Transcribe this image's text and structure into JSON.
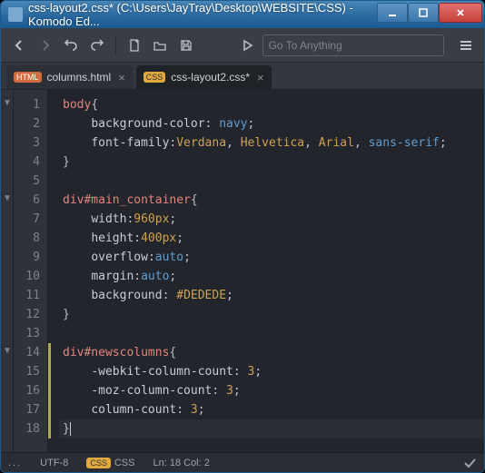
{
  "window": {
    "title": "css-layout2.css* (C:\\Users\\JayTray\\Desktop\\WEBSITE\\CSS) - Komodo Ed..."
  },
  "search": {
    "placeholder": "Go To Anything"
  },
  "tabs": [
    {
      "badge": "HTML",
      "label": "columns.html",
      "active": false
    },
    {
      "badge": "CSS",
      "label": "css-layout2.css*",
      "active": true
    }
  ],
  "code": {
    "lines": [
      {
        "n": 1,
        "fold": "▼",
        "html": "<span class='sel'>body</span><span class='brace'>{</span>"
      },
      {
        "n": 2,
        "html": "    <span class='prop'>background-color</span><span class='punc'>:</span> <span class='keyw'>navy</span><span class='punc'>;</span>"
      },
      {
        "n": 3,
        "html": "    <span class='prop'>font-family</span><span class='punc'>:</span><span class='val'>Verdana</span><span class='punc'>,</span> <span class='val'>Helvetica</span><span class='punc'>,</span> <span class='val'>Arial</span><span class='punc'>,</span> <span class='keyw'>sans-serif</span><span class='punc'>;</span>"
      },
      {
        "n": 4,
        "html": "<span class='brace'>}</span>"
      },
      {
        "n": 5,
        "html": ""
      },
      {
        "n": 6,
        "fold": "▼",
        "html": "<span class='sel'>div#main_container</span><span class='brace'>{</span>"
      },
      {
        "n": 7,
        "html": "    <span class='prop'>width</span><span class='punc'>:</span><span class='val'>960px</span><span class='punc'>;</span>"
      },
      {
        "n": 8,
        "html": "    <span class='prop'>height</span><span class='punc'>:</span><span class='val'>400px</span><span class='punc'>;</span>"
      },
      {
        "n": 9,
        "html": "    <span class='prop'>overflow</span><span class='punc'>:</span><span class='keyw'>auto</span><span class='punc'>;</span>"
      },
      {
        "n": 10,
        "html": "    <span class='prop'>margin</span><span class='punc'>:</span><span class='keyw'>auto</span><span class='punc'>;</span>"
      },
      {
        "n": 11,
        "html": "    <span class='prop'>background</span><span class='punc'>:</span> <span class='val'>#DEDEDE</span><span class='punc'>;</span>"
      },
      {
        "n": 12,
        "html": "<span class='brace'>}</span>"
      },
      {
        "n": 13,
        "html": ""
      },
      {
        "n": 14,
        "fold": "▼",
        "mod": true,
        "html": "<span class='sel'>div#newscolumns</span><span class='brace'>{</span>"
      },
      {
        "n": 15,
        "mod": true,
        "html": "    <span class='prop'>-webkit-column-count</span><span class='punc'>:</span> <span class='val'>3</span><span class='punc'>;</span>"
      },
      {
        "n": 16,
        "mod": true,
        "html": "    <span class='prop'>-moz-column-count</span><span class='punc'>:</span> <span class='val'>3</span><span class='punc'>;</span>"
      },
      {
        "n": 17,
        "mod": true,
        "html": "    <span class='prop'>column-count</span><span class='punc'>:</span> <span class='val'>3</span><span class='punc'>;</span>"
      },
      {
        "n": 18,
        "mod": true,
        "cursor": true,
        "html": "<span class='brace'>}</span><span class='cursor'></span>"
      }
    ]
  },
  "status": {
    "menu": "...",
    "encoding": "UTF-8",
    "langBadge": "CSS",
    "lang": "CSS",
    "pos": "Ln: 18 Col: 2"
  }
}
